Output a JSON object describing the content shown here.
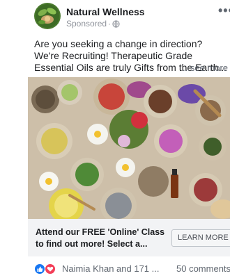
{
  "post": {
    "page_name": "Natural Wellness",
    "sponsored_label": "Sponsored",
    "privacy_separator": "·",
    "body_text": "Are you seeking a change in direction? We're Recruiting! Therapeutic Grade Essential Oils are truly Gifts from the Earth...",
    "see_more_label": "...see more"
  },
  "ad": {
    "image_icon": "herbs-and-essential-oils-photo",
    "cta_text": "Attend our FREE 'Online' Class to find out more! Select a...",
    "cta_button_label": "LEARN MORE"
  },
  "engagement": {
    "reaction_icons": [
      "like-icon",
      "love-icon"
    ],
    "reactions_text": "Naimia Khan and 171 ...",
    "comments_text": "50 comments"
  },
  "colors": {
    "like_blue": "#1877f2",
    "love_red": "#f33e58",
    "secondary_text": "#606770",
    "cta_bar_bg": "#f2f3f5"
  }
}
